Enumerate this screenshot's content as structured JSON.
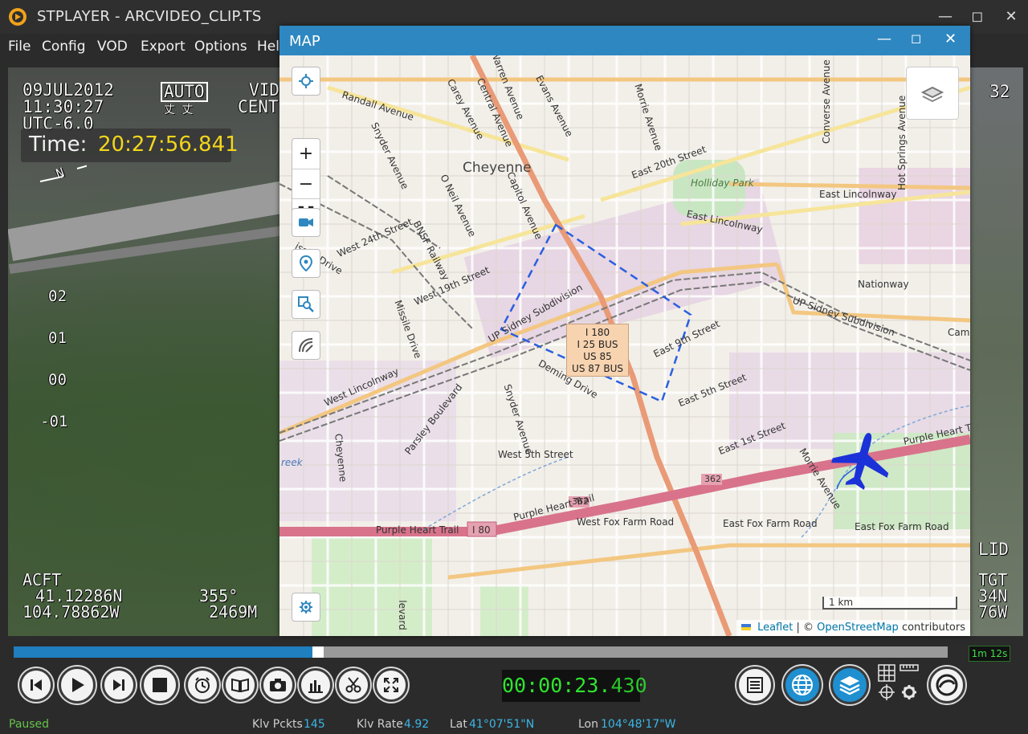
{
  "window": {
    "title": "STPLAYER - ARCVIDEO_CLIP.TS"
  },
  "menu": [
    "File",
    "Config",
    "VOD",
    "Export",
    "Options",
    "Help"
  ],
  "video_hud": {
    "date": "09JUL2012",
    "time": "11:30:27",
    "utc": "UTC-6.0",
    "mode": "AUTO",
    "mode_sub": "丈 丈",
    "vid_label": "VID",
    "cent_label": "CENT",
    "time_label": "Time:",
    "time_value": "20:27:56.841",
    "north": "N",
    "scale_marks": [
      "02",
      "01",
      "00",
      "-01"
    ],
    "acft_label": "ACFT",
    "acft_lat": "41.12286N",
    "acft_lon": "104.78862W",
    "acft_heading": "355°",
    "acft_alt": "2469M",
    "right_top_num": "32",
    "right_lid": "LID",
    "right_tgt": "TGT",
    "right_tgt_lat": "34N",
    "right_tgt_lon": "76W"
  },
  "map_window": {
    "title": "MAP",
    "controls": {
      "locate": "crosshair-icon",
      "zoom_in": "+",
      "zoom_out": "−",
      "fullscreen": "fullscreen-icon",
      "camera": "camera-icon",
      "marker": "marker-icon",
      "search": "search-icon",
      "draw": "draw-icon",
      "settings": "gear-icon"
    },
    "scale": "1 km",
    "attribution": {
      "leaflet": "Leaflet",
      "sep": "| ©",
      "osm": "OpenStreetMap",
      "tail": "contributors"
    },
    "tooltip": [
      "I 180",
      "I 25 BUS",
      "US 85",
      "US 87 BUS"
    ],
    "labels": {
      "city": "Cheyenne",
      "randall": "Randall Avenue",
      "carey": "Carey Avenue",
      "warren": "Warren Avenue",
      "evans": "Evans Avenue",
      "central": "Central Avenue",
      "morrie": "Morrie Avenue",
      "snyder": "Snyder Avenue",
      "oneil": "O Neil Avenue",
      "capitol": "Capitol Avenue",
      "east20": "East 20th Street",
      "holliday": "Holliday Park",
      "converse": "Converse Avenue",
      "hotsprings": "Hot Springs Avenue",
      "eastlincolnway_r": "East Lincolnway",
      "eastlincolnway_m": "East Lincolnway",
      "west24": "West 24th Street",
      "bnsf": "BNSF Railway",
      "drive": "issile Drive",
      "west19": "West 19th Street",
      "upsidney": "UP Sidney Subdivision",
      "upsidney_r": "UP Sidney Subdivision",
      "nationway": "Nationway",
      "camp": "Camp",
      "missiledrive": "Missile Drive",
      "east9": "East 9th Street",
      "westlincolnway": "West Lincolnway",
      "deming": "Deming Drive",
      "parsley": "Parsley Boulevard",
      "snyder2": "Snyder Avenue",
      "east5": "East 5th Street",
      "west5": "West 5th Street",
      "east1": "East 1st Street",
      "morrie2": "Morrie Avenue",
      "purpleheart_r": "Purple Heart Tra",
      "purpleheart_m": "Purple Heart Trail",
      "purpleheart_l": "Purple Heart Trail",
      "i80": "I 80",
      "rt362a": "362",
      "rt362b": "362",
      "westfox": "West Fox Farm Road",
      "eastfox1": "East Fox Farm Road",
      "eastfox2": "East Fox Farm Road",
      "cheyenne_v": "Cheyenne",
      "creek": "reek",
      "boulevard": "levard"
    }
  },
  "playback": {
    "progress_fraction": 0.32,
    "duration": "1m 12s",
    "timecode_main": "00:00:23.",
    "timecode_ms": "430",
    "buttons_left": [
      "skip-back-icon",
      "play-icon",
      "skip-forward-icon",
      "stop-icon",
      "timer-icon",
      "book-icon",
      "camera-icon",
      "chart-icon",
      "scissors-icon",
      "expand-icon"
    ],
    "buttons_right": [
      "list-icon",
      "globe-icon",
      "layers-icon",
      "grid-gear-icon",
      "logo-icon"
    ]
  },
  "status": {
    "state": "Paused",
    "klv_pckts_label": "Klv Pckts",
    "klv_pckts": "145",
    "klv_rate_label": "Klv Rate",
    "klv_rate": "4.92",
    "lat_label": "Lat",
    "lat": "41°07'51\"N",
    "lon_label": "Lon",
    "lon": "104°48'17\"W"
  },
  "colors": {
    "accent": "#2e87c0",
    "timecode": "#2ee52e",
    "status_value": "#3ab6e6",
    "plane": "#1b32d8",
    "footprint": "#2a5fe0"
  }
}
